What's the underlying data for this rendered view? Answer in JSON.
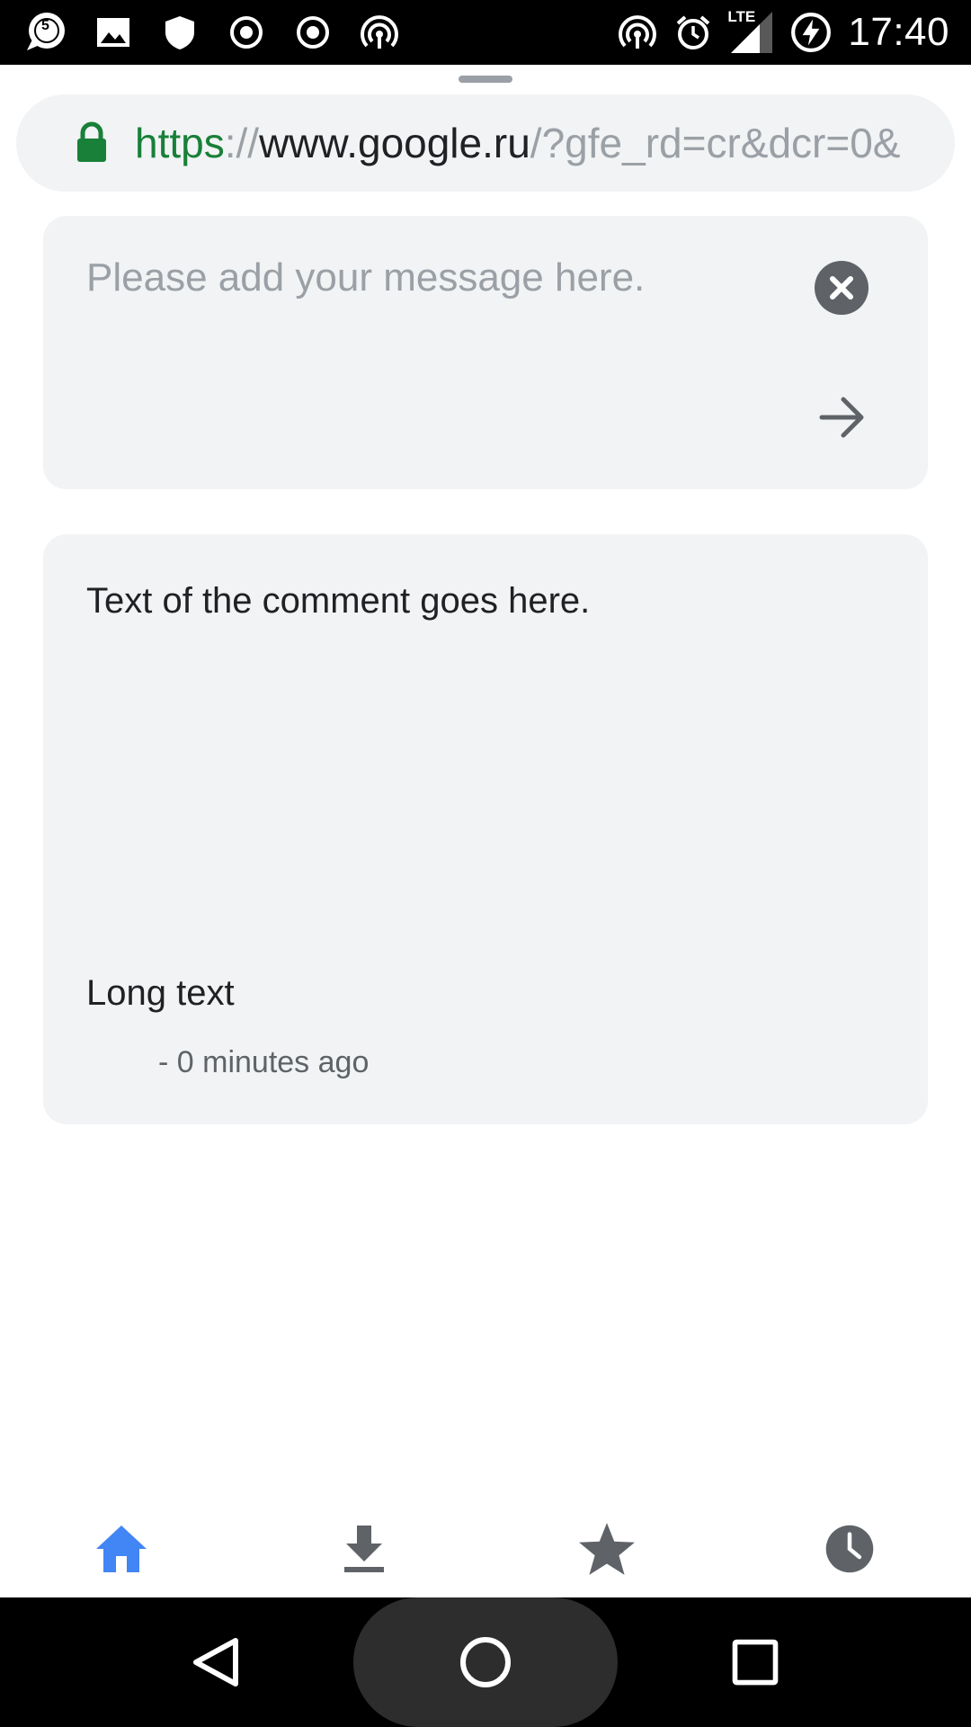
{
  "status_bar": {
    "time": "17:40",
    "notification_badge": "5",
    "network_label": "LTE",
    "left_icons": [
      "chat-bubble-icon",
      "image-icon",
      "shield-icon",
      "radio-icon",
      "radio-icon",
      "hotspot-icon"
    ],
    "right_icons": [
      "hotspot-icon",
      "alarm-icon",
      "signal-icon",
      "battery-charging-icon"
    ]
  },
  "url_bar": {
    "scheme": "https",
    "separator": "://",
    "host": "www.google.ru",
    "rest": "/?gfe_rd=cr&dcr=0&",
    "secure_color": "#188038"
  },
  "composer": {
    "placeholder": "Please add your message here.",
    "clear_icon": "close-circle-icon",
    "send_icon": "arrow-right-icon"
  },
  "comment": {
    "text": "Text of the comment goes here.",
    "author": "Long text",
    "time": "- 0 minutes ago"
  },
  "tabs": [
    {
      "name": "home",
      "icon": "home-icon",
      "active": true,
      "color": "#4285f4"
    },
    {
      "name": "downloads",
      "icon": "download-icon",
      "active": false,
      "color": "#5f6368"
    },
    {
      "name": "bookmarks",
      "icon": "star-icon",
      "active": false,
      "color": "#5f6368"
    },
    {
      "name": "history",
      "icon": "clock-icon",
      "active": false,
      "color": "#5f6368"
    }
  ],
  "nav": [
    "back-icon",
    "home-circle-icon",
    "recents-icon"
  ]
}
